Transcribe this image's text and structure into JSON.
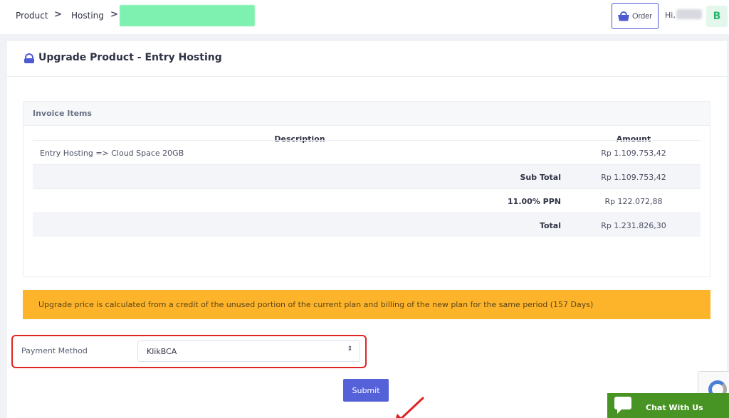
{
  "breadcrumb": {
    "items": [
      {
        "label": "Product"
      },
      {
        "label": "Hosting"
      }
    ],
    "separator": ">"
  },
  "header": {
    "order_label": "Order",
    "greeting": "Hi,",
    "avatar_initial": "B"
  },
  "card": {
    "title": "Upgrade Product - Entry Hosting"
  },
  "invoice": {
    "section_title": "Invoice Items",
    "columns": {
      "description": "Description",
      "amount": "Amount"
    },
    "items": [
      {
        "description": "Entry Hosting => Cloud Space 20GB",
        "amount": "Rp 1.109.753,42"
      }
    ],
    "subtotal": {
      "label": "Sub Total",
      "amount": "Rp 1.109.753,42"
    },
    "tax": {
      "label": "11.00% PPN",
      "amount": "Rp 122.072,88"
    },
    "total": {
      "label": "Total",
      "amount": "Rp 1.231.826,30"
    }
  },
  "notice": "Upgrade price is calculated from a credit of the unused portion of the current plan and billing of the new plan for the same period (157 Days)",
  "payment": {
    "label": "Payment Method",
    "selected": "KlikBCA",
    "caret": "⇕"
  },
  "submit_label": "Submit",
  "chat_label": "Chat With Us",
  "colors": {
    "accent": "#5561d9",
    "alert": "#fdb42a",
    "highlight": "#e02424",
    "chat": "#479323"
  }
}
